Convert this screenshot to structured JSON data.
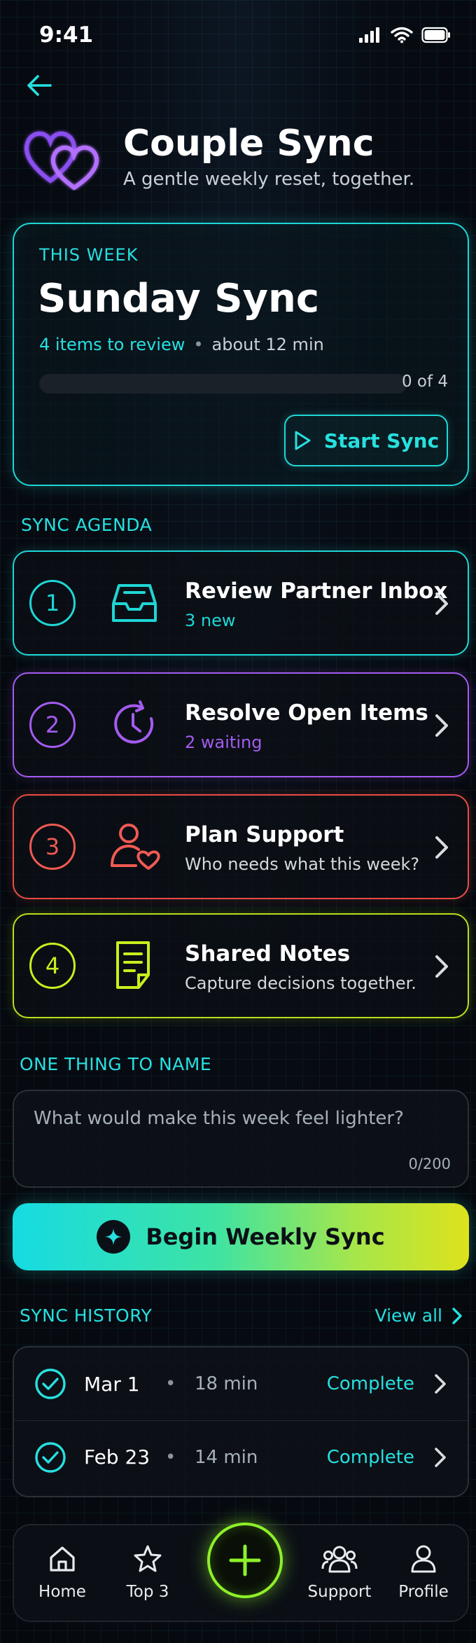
{
  "status_bar": {
    "time": "9:41"
  },
  "header": {
    "title": "Couple Sync",
    "subtitle": "A gentle weekly reset, together."
  },
  "this_week": {
    "eyebrow": "THIS WEEK",
    "title": "Sunday Sync",
    "items": "4 items to review",
    "separator": "•",
    "duration": "about 12 min",
    "progress_fraction": 0,
    "progress_label": "0 of 4",
    "start_label": "Start Sync"
  },
  "agenda": {
    "section_label": "SYNC AGENDA",
    "items": [
      {
        "number": "1",
        "title": "Review Partner Inbox",
        "subtitle": "3 new",
        "icon": "inbox-icon",
        "color": "#1fd6d6"
      },
      {
        "number": "2",
        "title": "Resolve Open Items",
        "subtitle": "2 waiting",
        "icon": "clock-refresh-icon",
        "color": "#a45bf0"
      },
      {
        "number": "3",
        "title": "Plan Support",
        "subtitle": "Who needs what this week?",
        "icon": "person-heart-icon",
        "color": "#f05a52"
      },
      {
        "number": "4",
        "title": "Shared Notes",
        "subtitle": "Capture decisions together.",
        "icon": "note-icon",
        "color": "#c9ef1d"
      }
    ]
  },
  "one_thing": {
    "section_label": "ONE THING TO NAME",
    "placeholder": "What would make this week feel lighter?",
    "counter": "0/200"
  },
  "begin_button": {
    "label": "Begin Weekly Sync"
  },
  "history": {
    "section_label": "SYNC HISTORY",
    "view_all": "View all",
    "rows": [
      {
        "date": "Mar 1",
        "separator": "•",
        "duration": "18 min",
        "status": "Complete"
      },
      {
        "date": "Feb 23",
        "separator": "•",
        "duration": "14 min",
        "status": "Complete"
      }
    ]
  },
  "tabbar": {
    "items": [
      {
        "label": "Home",
        "icon": "home-icon"
      },
      {
        "label": "Top 3",
        "icon": "star-icon"
      },
      {
        "label": "Support",
        "icon": "group-icon"
      },
      {
        "label": "Profile",
        "icon": "person-icon"
      }
    ],
    "fab_icon": "plus-icon"
  },
  "colors": {
    "cyan": "#1fd6d6",
    "purple": "#a45bf0",
    "red": "#f05a52",
    "lime": "#c9ef1d",
    "fab": "#8ef02a"
  }
}
